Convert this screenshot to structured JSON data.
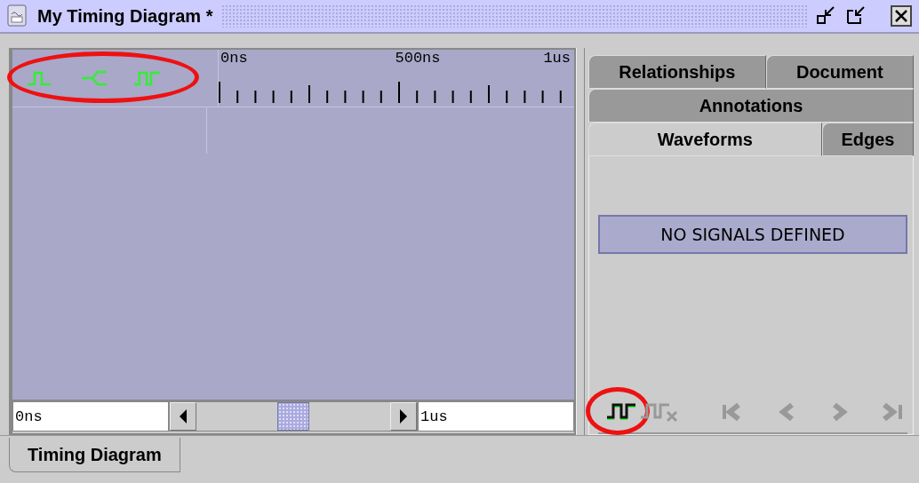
{
  "window": {
    "title": "My Timing Diagram *"
  },
  "diagram": {
    "signal_tools": [
      {
        "kind": "clock"
      },
      {
        "kind": "bus"
      },
      {
        "kind": "signal"
      }
    ],
    "signal_tools_circled": true,
    "ruler_labels": [
      "0ns",
      "500ns",
      "1us"
    ],
    "start_time": "0ns",
    "end_time": "1us"
  },
  "side_tabs": [
    [
      {
        "label": "Relationships",
        "selected": false
      },
      {
        "label": "Document",
        "selected": false
      }
    ],
    [
      {
        "label": "Annotations",
        "selected": false
      }
    ],
    [
      {
        "label": "Waveforms",
        "selected": true
      },
      {
        "label": "Edges",
        "selected": false
      }
    ]
  ],
  "waveforms": {
    "message": "NO SIGNALS DEFINED",
    "toolbar": [
      {
        "kind": "add-signal",
        "disabled": false,
        "circled": true
      },
      {
        "kind": "delete-signal",
        "disabled": true,
        "circled": false
      },
      {
        "kind": "first",
        "disabled": true,
        "circled": false
      },
      {
        "kind": "previous",
        "disabled": true,
        "circled": false
      },
      {
        "kind": "next",
        "disabled": true,
        "circled": false
      },
      {
        "kind": "last",
        "disabled": true,
        "circled": false
      }
    ]
  },
  "document_tabs": [
    {
      "label": "Timing Diagram",
      "selected": true
    }
  ]
}
